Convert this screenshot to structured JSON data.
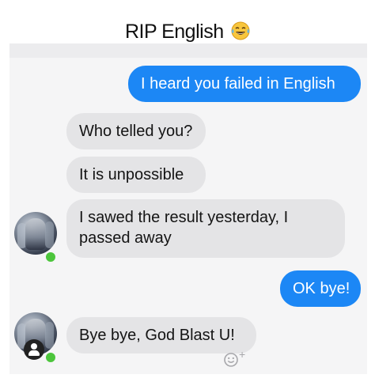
{
  "caption": {
    "text": "RIP English",
    "emoji": "tears-of-joy-emoji"
  },
  "conversation": {
    "messages": [
      {
        "side": "outgoing",
        "text": "I heard you failed in English"
      },
      {
        "side": "incoming",
        "text": "Who telled you?"
      },
      {
        "side": "incoming",
        "text": "It is unpossible"
      },
      {
        "side": "incoming",
        "line1": "I sawed the result yesterday, I",
        "line2": "passed away"
      },
      {
        "side": "outgoing",
        "text": "OK bye!"
      },
      {
        "side": "incoming",
        "text": "Bye bye, God Blast U!"
      }
    ],
    "reaction_icon": "add-reaction-icon",
    "reaction_plus": "+"
  },
  "colors": {
    "outgoing_bubble": "#1c87f5",
    "incoming_bubble": "#e4e4e6",
    "online_dot": "#4cc53c",
    "chat_background": "#f5f5f6"
  }
}
